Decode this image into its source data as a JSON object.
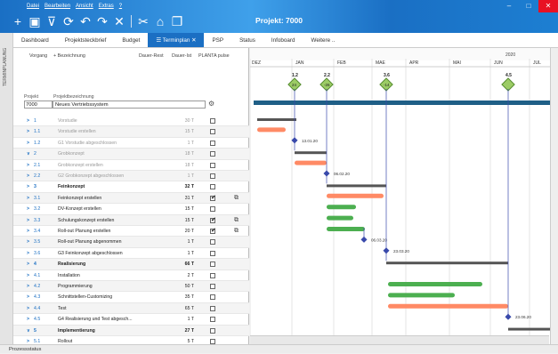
{
  "window": {
    "title": "Projekt: 7000",
    "menu": [
      "Datei",
      "Bearbeiten",
      "Ansicht",
      "Extras",
      "?"
    ],
    "toolbar_icons": [
      "add-icon",
      "save-icon",
      "filter-icon",
      "refresh-icon",
      "undo-icon",
      "redo-icon",
      "delete-icon",
      "tools-icon",
      "home-icon",
      "copy-icon"
    ],
    "controls": {
      "minimize": "–",
      "maximize": "□",
      "close": "✕"
    }
  },
  "sidebar_strip": {
    "label": "TERMINPLANUNG"
  },
  "tabs": [
    {
      "label": "Dashboard",
      "active": false
    },
    {
      "label": "Projektsteckbrief",
      "active": false
    },
    {
      "label": "Budget",
      "active": false
    },
    {
      "label": "Terminplan",
      "active": true,
      "close": "✕"
    },
    {
      "label": "PSP",
      "active": false
    },
    {
      "label": "Status",
      "active": false
    },
    {
      "label": "Infoboard",
      "active": false
    },
    {
      "label": "Weitere ..",
      "active": false
    }
  ],
  "table_header": {
    "vorgang": "Vorgang",
    "bezeichnung": "+ Bezeichnung",
    "dauer_rest": "Dauer-Rest",
    "dauer_ist": "Dauer-Ist",
    "pulse": "PLANTA pulse"
  },
  "project": {
    "id_label": "Projekt",
    "desc_label": "Projektbezeichnung",
    "id": "7000",
    "name": "Neues Vertriebssystem"
  },
  "rows": [
    {
      "caret": ">",
      "num": "1",
      "desc": "Vorstudie",
      "dur": "30 T",
      "checked": false,
      "style": "grey",
      "ext": false
    },
    {
      "caret": ">",
      "num": "1.1",
      "desc": "Vorstudie erstellen",
      "dur": "15 T",
      "checked": false,
      "style": "grey",
      "ext": false
    },
    {
      "caret": ">",
      "num": "1.2",
      "desc": "G1 Vorstudie abgeschlossen",
      "dur": "1 T",
      "checked": false,
      "style": "grey",
      "ext": false
    },
    {
      "caret": "∨",
      "num": "2",
      "desc": "Grobkonzept",
      "dur": "18 T",
      "checked": false,
      "style": "grey",
      "ext": false
    },
    {
      "caret": ">",
      "num": "2.1",
      "desc": "Grobkonzept erstellen",
      "dur": "18 T",
      "checked": false,
      "style": "grey",
      "ext": false
    },
    {
      "caret": ">",
      "num": "2.2",
      "desc": "G2 Grobkonzept abgeschlossen",
      "dur": "1 T",
      "checked": false,
      "style": "grey",
      "ext": false
    },
    {
      "caret": ">",
      "num": "3",
      "desc": "Feinkonzept",
      "dur": "32 T",
      "checked": false,
      "style": "bold",
      "ext": false
    },
    {
      "caret": ">",
      "num": "3.1",
      "desc": "Feinkonzept erstellen",
      "dur": "31 T",
      "checked": true,
      "style": "",
      "ext": true
    },
    {
      "caret": ">",
      "num": "3.2",
      "desc": "DV-Konzept erstellen",
      "dur": "15 T",
      "checked": false,
      "style": "",
      "ext": false
    },
    {
      "caret": ">",
      "num": "3.3",
      "desc": "Schulungskonzept erstellen",
      "dur": "15 T",
      "checked": true,
      "style": "",
      "ext": true
    },
    {
      "caret": ">",
      "num": "3.4",
      "desc": "Roll-out Planung erstellen",
      "dur": "20 T",
      "checked": true,
      "style": "",
      "ext": true
    },
    {
      "caret": ">",
      "num": "3.5",
      "desc": "Roll-out Planung abgenommen",
      "dur": "1 T",
      "checked": false,
      "style": "",
      "ext": false
    },
    {
      "caret": ">",
      "num": "3.6",
      "desc": "G3 Feinkonzept abgeschlossen",
      "dur": "1 T",
      "checked": false,
      "style": "",
      "ext": false
    },
    {
      "caret": ">",
      "num": "4",
      "desc": "Realisierung",
      "dur": "66 T",
      "checked": false,
      "style": "bold",
      "ext": false
    },
    {
      "caret": ">",
      "num": "4.1",
      "desc": "Installation",
      "dur": "2 T",
      "checked": false,
      "style": "",
      "ext": false
    },
    {
      "caret": ">",
      "num": "4.2",
      "desc": "Programmierung",
      "dur": "50 T",
      "checked": false,
      "style": "",
      "ext": false
    },
    {
      "caret": ">",
      "num": "4.3",
      "desc": "Schnittstellen-Customizing",
      "dur": "35 T",
      "checked": false,
      "style": "",
      "ext": false
    },
    {
      "caret": ">",
      "num": "4.4",
      "desc": "Test",
      "dur": "65 T",
      "checked": false,
      "style": "",
      "ext": false
    },
    {
      "caret": ">",
      "num": "4.5",
      "desc": "G4 Realisierung und Test abgesch...",
      "dur": "1 T",
      "checked": false,
      "style": "",
      "ext": false
    },
    {
      "caret": "∨",
      "num": "5",
      "desc": "Implementierung",
      "dur": "27 T",
      "checked": false,
      "style": "bold",
      "ext": false
    },
    {
      "caret": ">",
      "num": "5.1",
      "desc": "Rollout",
      "dur": "5 T",
      "checked": false,
      "style": "",
      "ext": false
    }
  ],
  "gantt": {
    "year": "2020",
    "months": [
      "DEZ",
      "JAN",
      "FEB",
      "MAE",
      "APR",
      "MAI",
      "JUN",
      "JUL"
    ],
    "milestones": [
      {
        "label": "1.2",
        "value": "24"
      },
      {
        "label": "2.2",
        "value": "-26"
      },
      {
        "label": "3.6",
        "value": "-14"
      },
      {
        "label": "4.5",
        "value": ""
      }
    ],
    "dates": [
      "13.01.20",
      "06.02.20",
      "06.03.20",
      "23.03.20",
      "23.06.20"
    ],
    "colors": {
      "summary": "#555555",
      "done": "#ff8a65",
      "progress": "#4caf50",
      "milestone": "#3949ab",
      "header_bar": "#1f5f86"
    }
  },
  "status": {
    "text": "Prozessstatus"
  }
}
